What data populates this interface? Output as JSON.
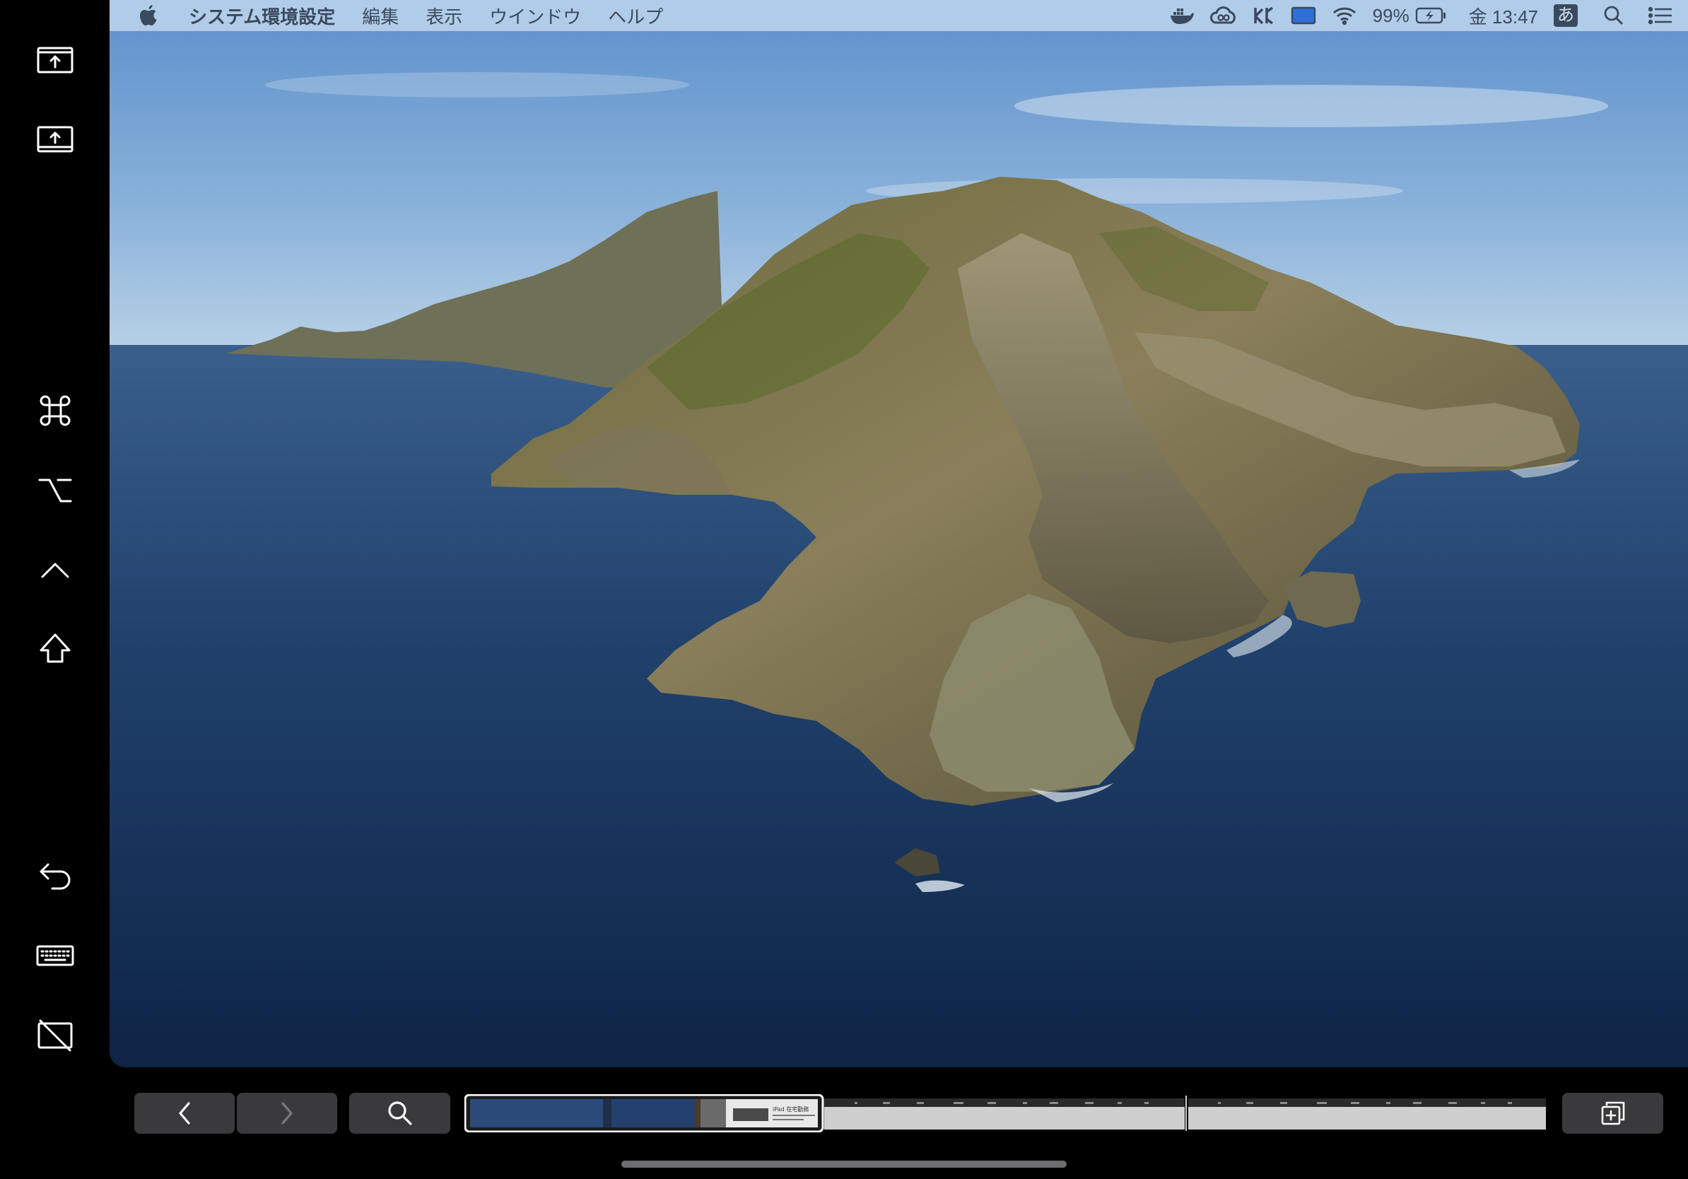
{
  "menubar": {
    "apple_icon": "apple-logo-icon",
    "app_name": "システム環境設定",
    "menus": [
      "編集",
      "表示",
      "ウインドウ",
      "ヘルプ"
    ],
    "status": {
      "battery_percent": "99%",
      "clock": "金 13:47",
      "input_method": "あ",
      "icons": [
        "docker-icon",
        "creative-cloud-icon",
        "network-monitor-icon",
        "sidecar-display-icon",
        "wifi-icon",
        "battery-charging-icon",
        "input-method-icon",
        "spotlight-search-icon",
        "notification-center-icon"
      ]
    }
  },
  "sidebar": {
    "buttons": [
      "show-menu-bar-icon",
      "show-dock-icon",
      "command-key-icon",
      "option-key-icon",
      "control-key-icon",
      "shift-key-icon",
      "undo-icon",
      "keyboard-icon",
      "disconnect-display-icon"
    ]
  },
  "touchbar": {
    "buttons": [
      "back-chevron-icon",
      "forward-chevron-icon",
      "search-icon",
      "new-tab-icon"
    ],
    "tab_preview_text": "iPad 在宅勤務"
  },
  "colors": {
    "accent": "#3a4a5e",
    "touchbar_button": "#3a3a3c",
    "menubar": "#bcd4ec"
  }
}
